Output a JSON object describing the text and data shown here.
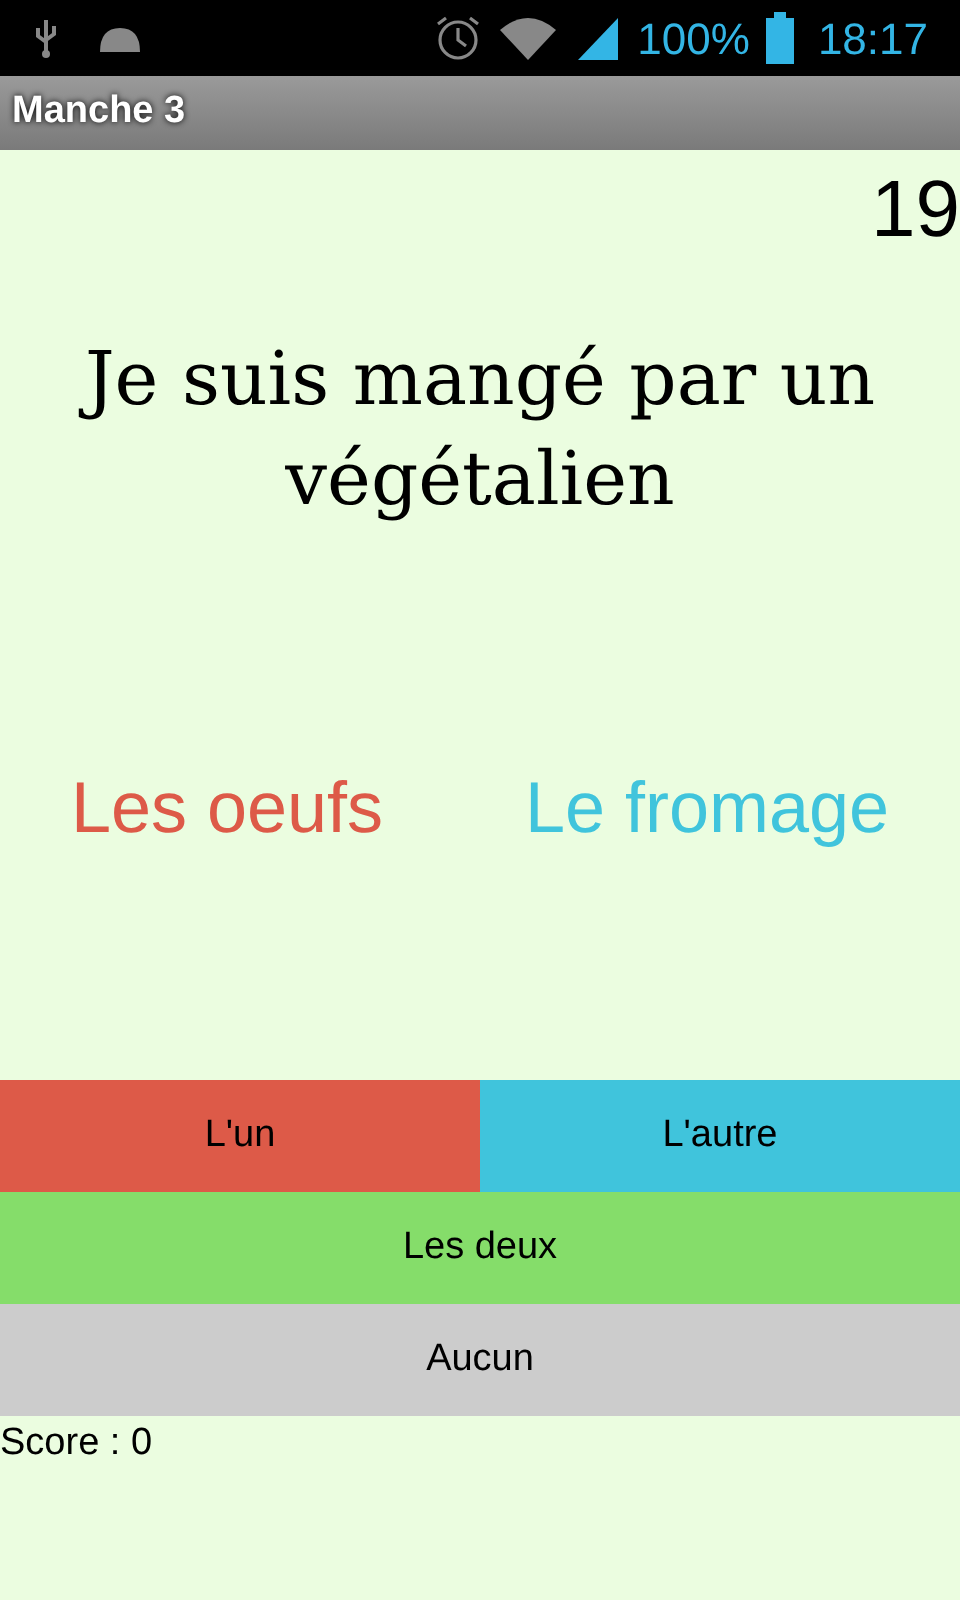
{
  "status_bar": {
    "battery": "100%",
    "time": "18:17"
  },
  "title_bar": {
    "title": "Manche 3"
  },
  "counter": "19",
  "question": "Je suis mangé par un végétalien",
  "options": [
    {
      "label": "Les oeufs",
      "color": "#dd5a48"
    },
    {
      "label": "Le fromage",
      "color": "#40c4dc"
    }
  ],
  "buttons": [
    {
      "label": "L'un",
      "color": "#dd5a48"
    },
    {
      "label": "L'autre",
      "color": "#40c4dc"
    },
    {
      "label": "Les deux",
      "color": "#85dd6a"
    },
    {
      "label": "Aucun",
      "color": "#cccccc"
    }
  ],
  "score": "Score : 0"
}
